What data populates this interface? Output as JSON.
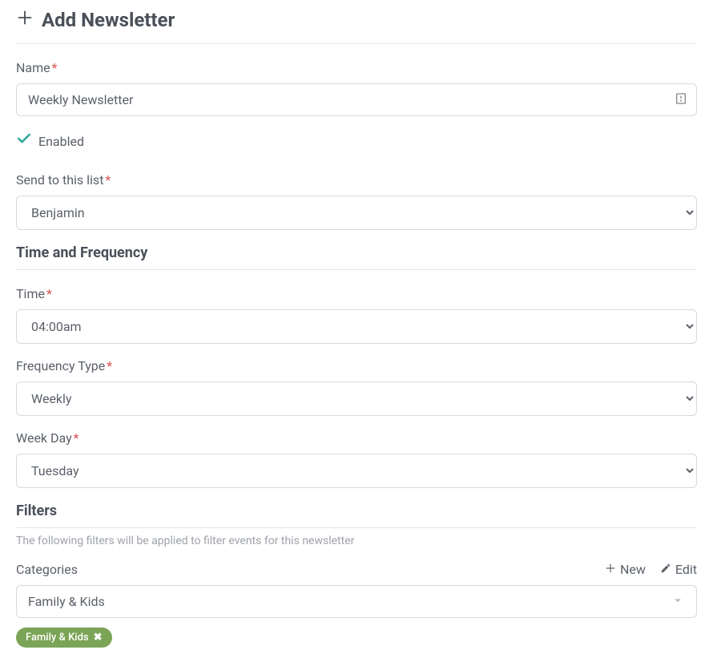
{
  "header": {
    "title": "Add Newsletter"
  },
  "name": {
    "label": "Name",
    "value": "Weekly Newsletter"
  },
  "enabled": {
    "label": "Enabled",
    "checked": true
  },
  "sendToList": {
    "label": "Send to this list",
    "value": "Benjamin"
  },
  "sections": {
    "timeFrequency": "Time and Frequency",
    "filters": "Filters",
    "filtersSubtext": "The following filters will be applied to filter events for this newsletter"
  },
  "time": {
    "label": "Time",
    "value": "04:00am"
  },
  "frequencyType": {
    "label": "Frequency Type",
    "value": "Weekly"
  },
  "weekDay": {
    "label": "Week Day",
    "value": "Tuesday"
  },
  "categories": {
    "label": "Categories",
    "newLabel": "New",
    "editLabel": "Edit",
    "value": "Family & Kids",
    "tags": [
      "Family & Kids"
    ]
  }
}
